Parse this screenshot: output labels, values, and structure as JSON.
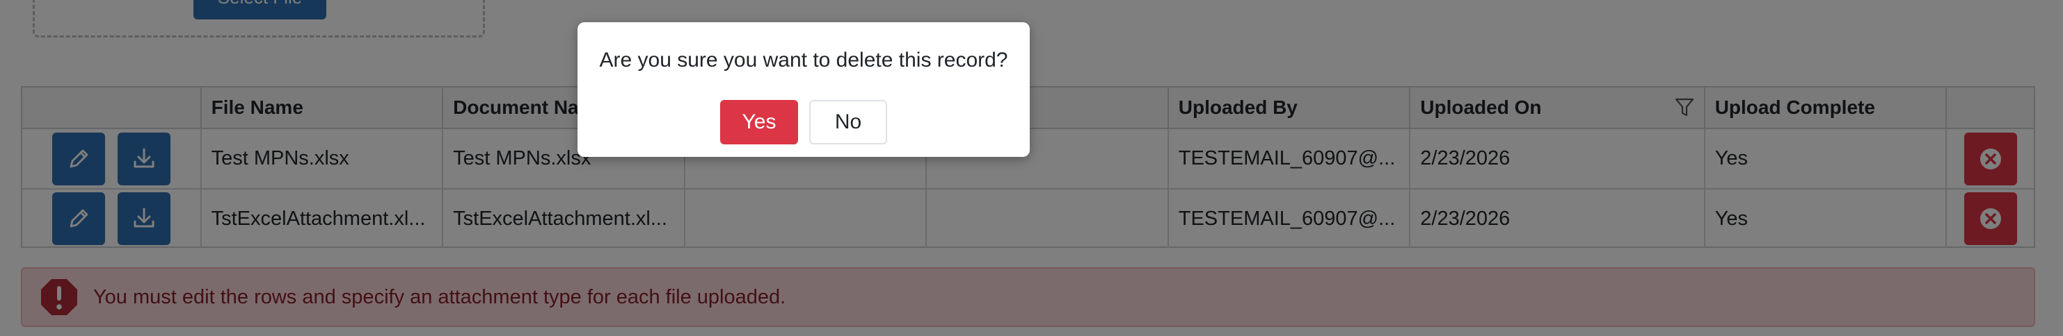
{
  "upload": {
    "select_file_label": "Select File"
  },
  "grid": {
    "columns": [
      "",
      "File Name",
      "Document Name",
      "",
      "",
      "Uploaded By",
      "Uploaded On",
      "Upload Complete",
      ""
    ],
    "rows": [
      {
        "file_name": "Test MPNs.xlsx",
        "document_name": "Test MPNs.xlsx",
        "col3": "",
        "col4": "",
        "uploaded_by": "TESTEMAIL_60907@...",
        "uploaded_on": "2/23/2026",
        "upload_complete": "Yes"
      },
      {
        "file_name": "TstExcelAttachment.xl...",
        "document_name": "TstExcelAttachment.xl...",
        "col3": "",
        "col4": "",
        "uploaded_by": "TESTEMAIL_60907@...",
        "uploaded_on": "2/23/2026",
        "upload_complete": "Yes"
      }
    ]
  },
  "alert": {
    "message": "You must edit the rows and specify an attachment type for each file uploaded."
  },
  "dialog": {
    "message": "Are you sure you want to delete this record?",
    "yes_label": "Yes",
    "no_label": "No"
  },
  "colors": {
    "primary": "#2e6fb0",
    "danger": "#dc3545",
    "alert_bg": "#f8d7da",
    "alert_text": "#842029"
  },
  "icons": {
    "edit": "pencil-icon",
    "download": "download-icon",
    "delete": "circle-x-icon",
    "filter": "filter-icon",
    "alert": "exclamation-octagon-icon"
  }
}
